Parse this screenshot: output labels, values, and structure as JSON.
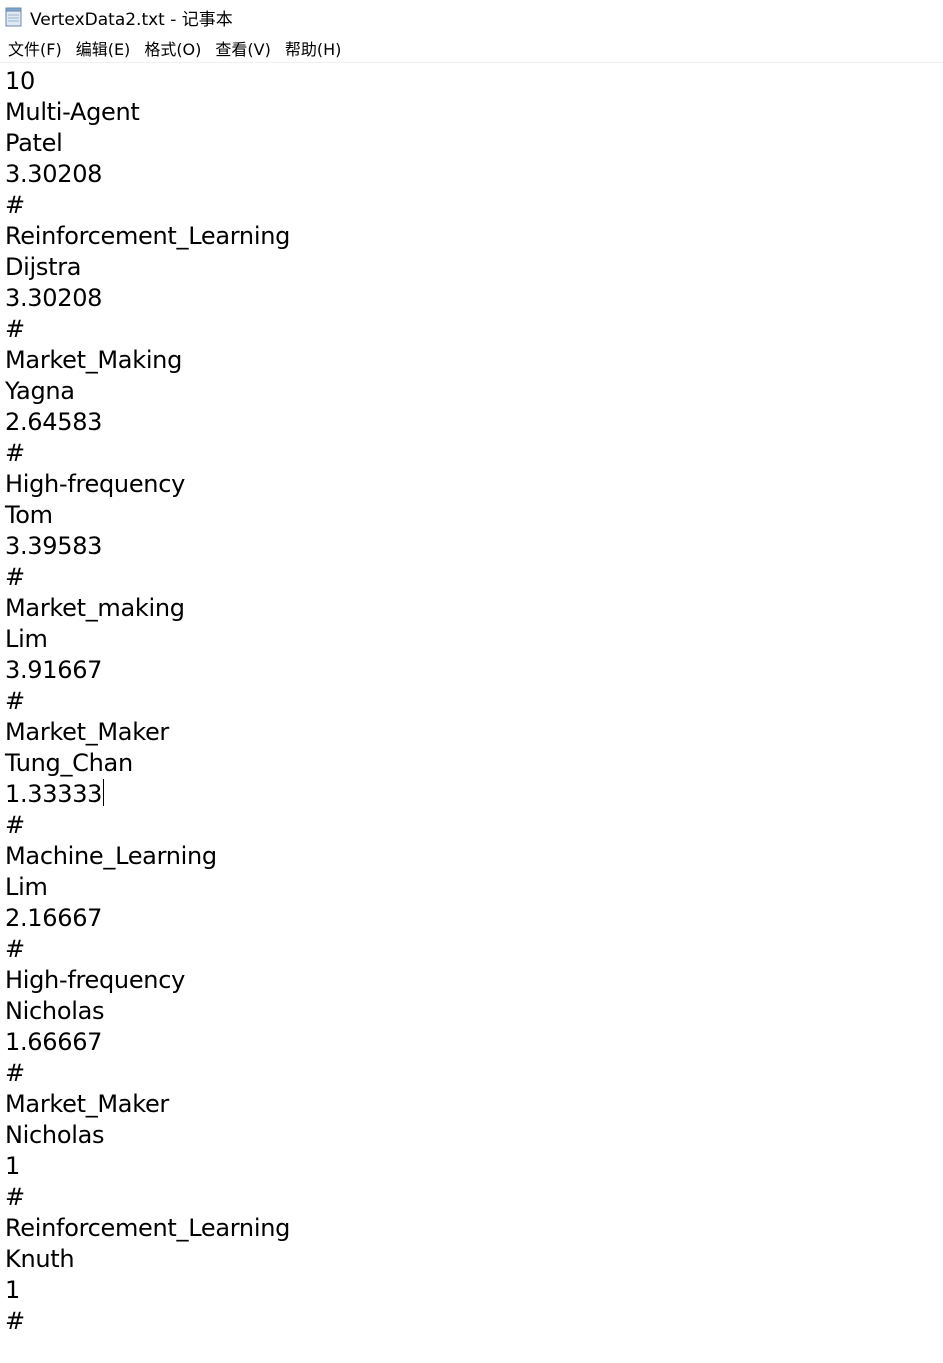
{
  "window": {
    "title": "VertexData2.txt - 记事本",
    "icon": "notepad-icon"
  },
  "menu": {
    "items": [
      {
        "label": "文件(F)"
      },
      {
        "label": "编辑(E)"
      },
      {
        "label": "格式(O)"
      },
      {
        "label": "查看(V)"
      },
      {
        "label": "帮助(H)"
      }
    ]
  },
  "editor": {
    "caret_line": 23,
    "lines": [
      "10",
      "Multi-Agent",
      "Patel",
      "3.30208",
      "#",
      "Reinforcement_Learning",
      "Dijstra",
      "3.30208",
      "#",
      "Market_Making",
      "Yagna",
      "2.64583",
      "#",
      "High-frequency",
      "Tom",
      "3.39583",
      "#",
      "Market_making",
      "Lim",
      "3.91667",
      "#",
      "Market_Maker",
      "Tung_Chan",
      "1.33333",
      "#",
      "Machine_Learning",
      "Lim",
      "2.16667",
      "#",
      "High-frequency",
      "Nicholas",
      "1.66667",
      "#",
      "Market_Maker",
      "Nicholas",
      "1",
      "#",
      "Reinforcement_Learning",
      "Knuth",
      "1",
      "#"
    ]
  }
}
